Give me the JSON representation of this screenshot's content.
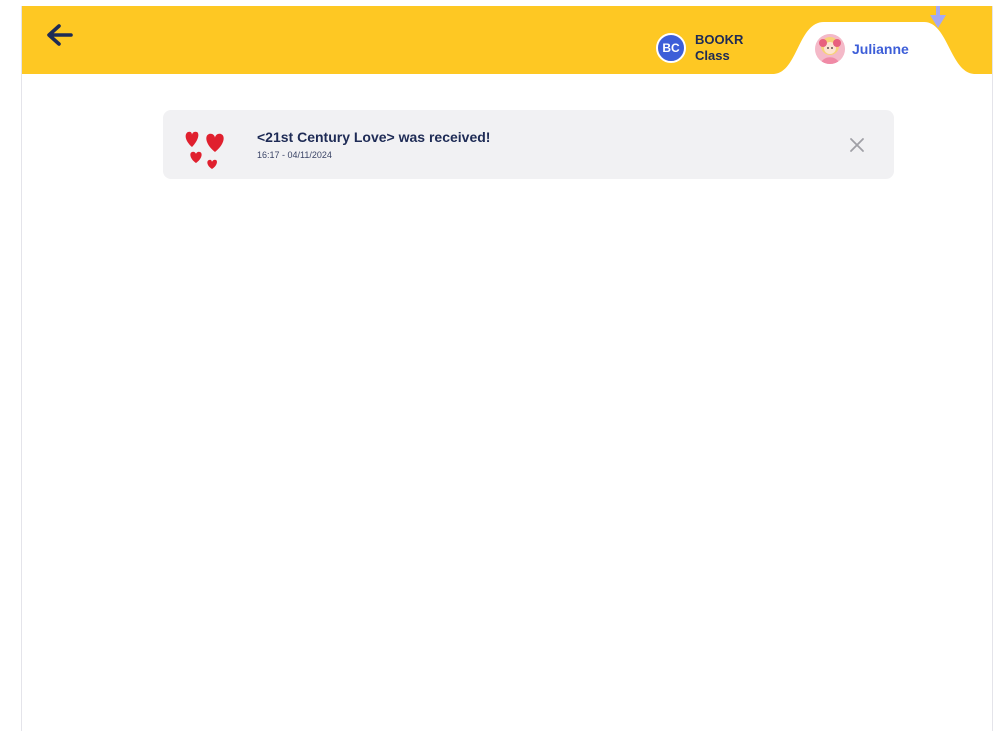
{
  "header": {
    "back_icon": "arrow-left-icon",
    "class_tab": {
      "initials": "BC",
      "name": "BOOKR Class"
    },
    "profile_tab": {
      "name": "Julianne",
      "avatar_icon": "girl-avatar-icon"
    }
  },
  "notifications": [
    {
      "icon": "hearts-icon",
      "title": "<21st Century Love> was received!",
      "timestamp": "16:17 - 04/11/2024",
      "close_icon": "close-icon"
    }
  ],
  "colors": {
    "header_bg": "#fec823",
    "accent_blue": "#3d5ed8",
    "text_dark": "#1e2b55",
    "card_bg": "#f1f1f3",
    "heart_red": "#e0202e"
  }
}
